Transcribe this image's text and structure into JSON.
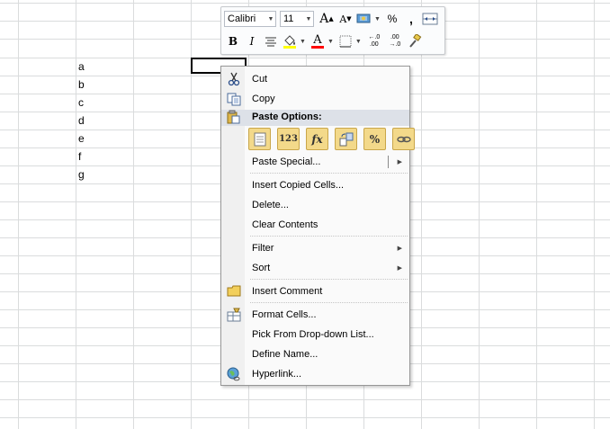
{
  "column_a_values": [
    "a",
    "b",
    "c",
    "d",
    "e",
    "f",
    "g"
  ],
  "mini_toolbar": {
    "font_name": "Calibri",
    "font_size": "11",
    "grow_font": "A",
    "shrink_font": "A",
    "percent": "%",
    "comma": ",",
    "bold": "B",
    "italic": "I",
    "font_color_letter": "A",
    "inc_decimal": "←.0 .00",
    "dec_decimal": ".00 →.0"
  },
  "menu": {
    "cut": "Cut",
    "copy": "Copy",
    "paste_options_header": "Paste Options:",
    "paste_buttons": [
      "paste",
      "123",
      "fx",
      "transpose",
      "%",
      "link"
    ],
    "paste_special": "Paste Special...",
    "insert_copied_cells": "Insert Copied Cells...",
    "delete": "Delete...",
    "clear_contents": "Clear Contents",
    "filter": "Filter",
    "sort": "Sort",
    "insert_comment": "Insert Comment",
    "format_cells": "Format Cells...",
    "pick_from_list": "Pick From Drop-down List...",
    "define_name": "Define Name...",
    "hyperlink": "Hyperlink..."
  },
  "colors": {
    "font_color_bar": "#ff0000",
    "highlight": "#ffff00",
    "grid": "#dadcdd",
    "header_band": "#dde1e8"
  }
}
